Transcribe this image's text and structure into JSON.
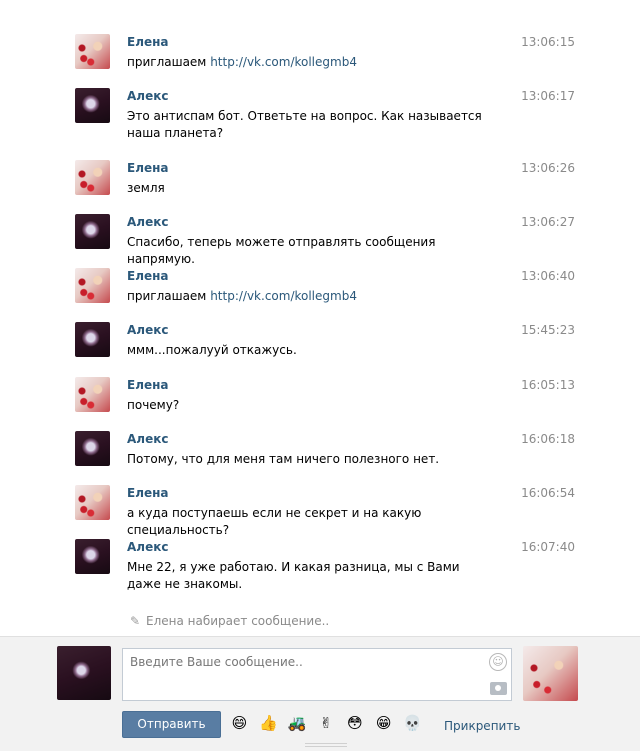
{
  "conversation": {
    "messages": [
      {
        "author": "Елена",
        "time": "13:06:15",
        "text": "приглашаем ",
        "link": "http://vk.com/kollegmb4"
      },
      {
        "author": "Алекс",
        "time": "13:06:17",
        "text": "Это антиспам бот. Ответьте на вопрос. Как называется наша планета?",
        "link": ""
      },
      {
        "author": "Елена",
        "time": "13:06:26",
        "text": "земля",
        "link": ""
      },
      {
        "author": "Алекс",
        "time": "13:06:27",
        "text": "Спасибо, теперь можете отправлять сообщения напрямую.",
        "link": ""
      },
      {
        "author": "Елена",
        "time": "13:06:40",
        "text": "приглашаем ",
        "link": "http://vk.com/kollegmb4"
      },
      {
        "author": "Алекс",
        "time": "15:45:23",
        "text": "ммм...пожалууй откажусь.",
        "link": ""
      },
      {
        "author": "Елена",
        "time": "16:05:13",
        "text": "почему?",
        "link": ""
      },
      {
        "author": "Алекс",
        "time": "16:06:18",
        "text": "Потому, что для меня там ничего полезного нет.",
        "link": ""
      },
      {
        "author": "Елена",
        "time": "16:06:54",
        "text": "а куда поступаешь если не секрет и на какую специальность?",
        "link": ""
      },
      {
        "author": "Алекс",
        "time": "16:07:40",
        "text": "Мне 22, я уже работаю. И какая разница, мы с Вами даже не знакомы.",
        "link": ""
      }
    ],
    "typing_indicator": "Елена набирает сообщение.."
  },
  "composer": {
    "placeholder": "Введите Ваше сообщение..",
    "send_label": "Отправить",
    "attach_label": "Прикрепить",
    "emojis": [
      "😄",
      "👍",
      "🚜",
      "✌",
      "😳",
      "😁",
      "💀"
    ]
  },
  "colors": {
    "link": "#2b587a",
    "author": "#2b587a",
    "button": "#597da3",
    "timestamp": "#8a8a8a"
  }
}
